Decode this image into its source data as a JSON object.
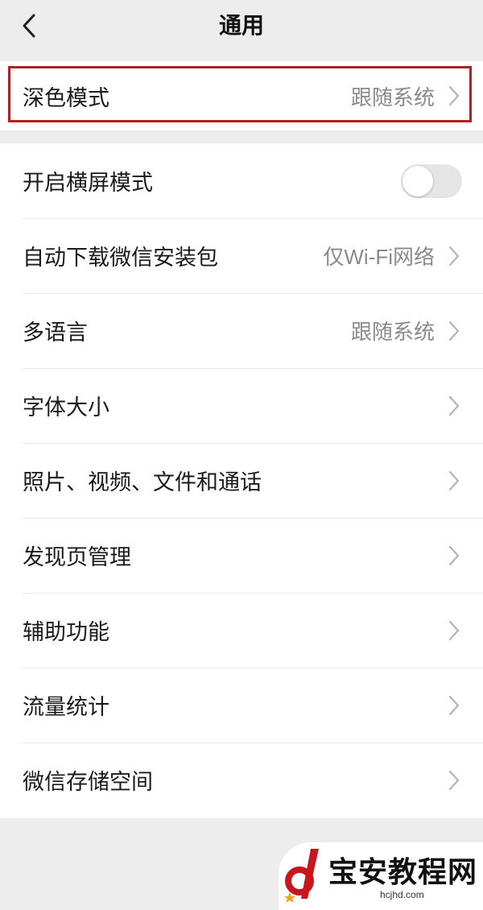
{
  "header": {
    "title": "通用"
  },
  "highlight_color": "#b01f24",
  "group1": {
    "dark_mode": {
      "label": "深色模式",
      "value": "跟随系统"
    }
  },
  "group2": {
    "landscape": {
      "label": "开启横屏模式",
      "toggle_on": false
    },
    "auto_download": {
      "label": "自动下载微信安装包",
      "value": "仅Wi-Fi网络"
    },
    "language": {
      "label": "多语言",
      "value": "跟随系统"
    },
    "font_size": {
      "label": "字体大小"
    },
    "media": {
      "label": "照片、视频、文件和通话"
    },
    "discover": {
      "label": "发现页管理"
    },
    "accessibility": {
      "label": "辅助功能"
    },
    "traffic": {
      "label": "流量统计"
    },
    "storage": {
      "label": "微信存储空间"
    }
  },
  "watermark": {
    "name": "宝安教程网",
    "domain": "hcjhd.com"
  }
}
